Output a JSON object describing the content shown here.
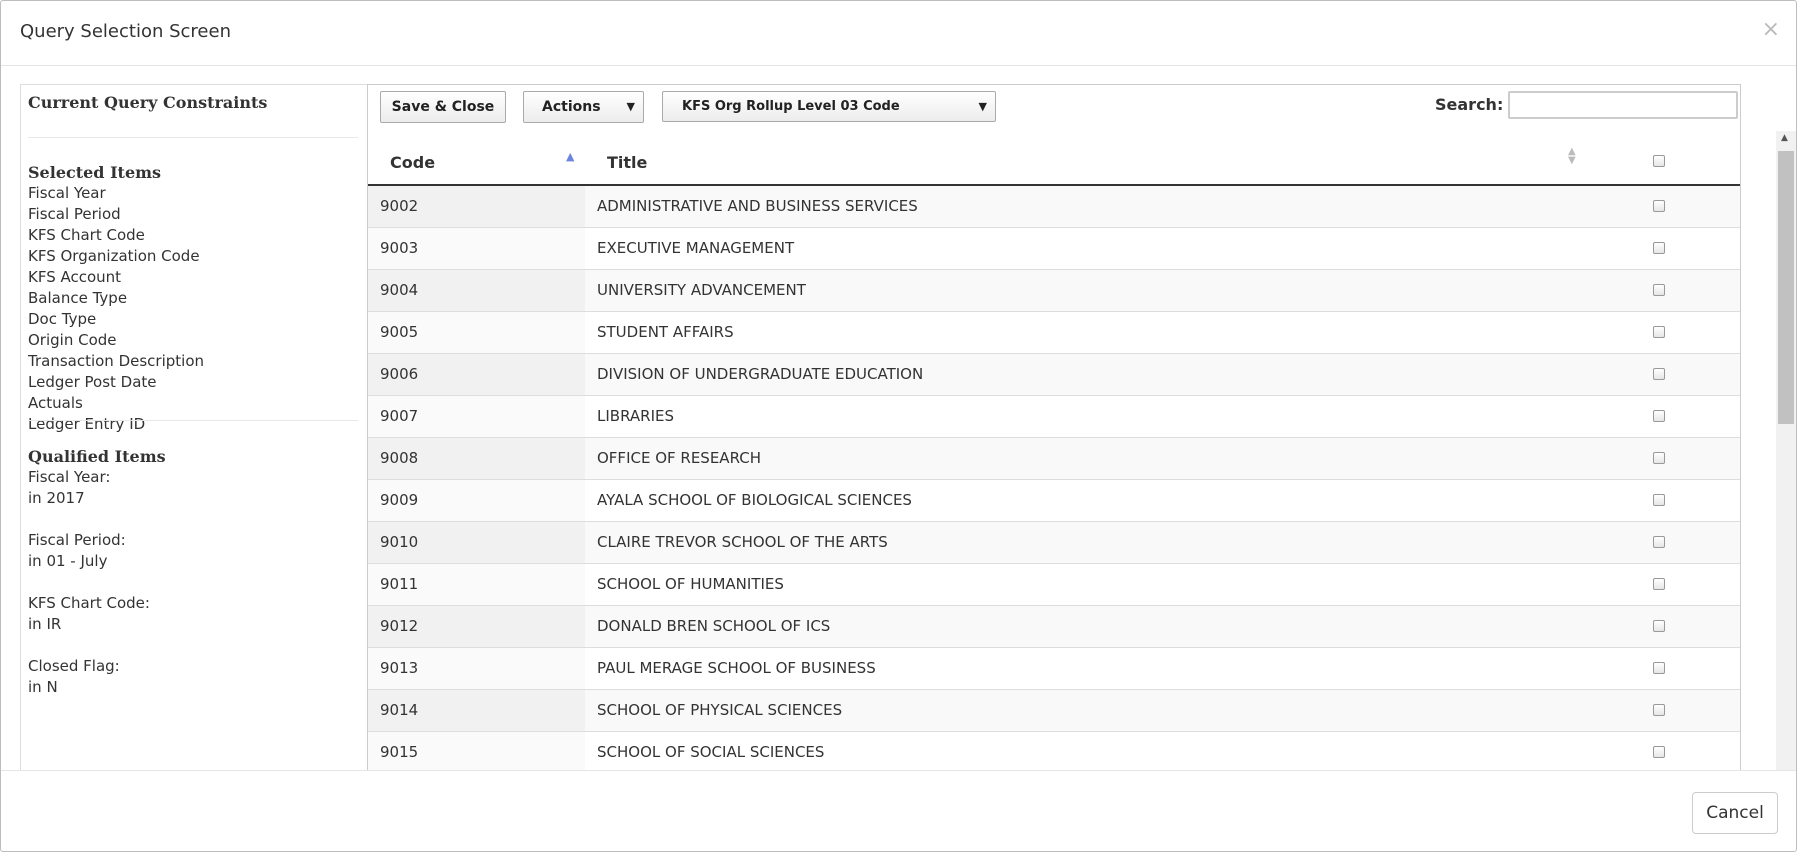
{
  "modal": {
    "title": "Query Selection Screen",
    "close_glyph": "×",
    "cancel_label": "Cancel"
  },
  "left_panel": {
    "title": "Current Query Constraints",
    "selected_heading": "Selected Items",
    "selected_items": [
      "Fiscal Year",
      "Fiscal Period",
      "KFS Chart Code",
      "KFS Organization Code",
      "KFS Account",
      "Balance Type",
      "Doc Type",
      "Origin Code",
      "Transaction Description",
      "Ledger Post Date",
      "Actuals",
      "Ledger Entry ID"
    ],
    "qualified_heading": "Qualified Items",
    "qualified_items": [
      {
        "label": "Fiscal Year:",
        "value": "in 2017"
      },
      {
        "label": "Fiscal Period:",
        "value": "in 01 - July"
      },
      {
        "label": "KFS Chart Code:",
        "value": "in IR"
      },
      {
        "label": "Closed Flag:",
        "value": "in N"
      }
    ]
  },
  "toolbar": {
    "save_close_label": "Save & Close",
    "actions_label": "Actions",
    "dimension_label": "KFS Org Rollup Level 03 Code",
    "caret_glyph": "▼",
    "search_label": "Search:",
    "search_value": ""
  },
  "table": {
    "columns": [
      "Code",
      "Title"
    ],
    "sort_column": "Code",
    "rows": [
      {
        "code": "9002",
        "title": "ADMINISTRATIVE AND BUSINESS SERVICES"
      },
      {
        "code": "9003",
        "title": "EXECUTIVE MANAGEMENT"
      },
      {
        "code": "9004",
        "title": "UNIVERSITY ADVANCEMENT"
      },
      {
        "code": "9005",
        "title": "STUDENT AFFAIRS"
      },
      {
        "code": "9006",
        "title": "DIVISION OF UNDERGRADUATE EDUCATION"
      },
      {
        "code": "9007",
        "title": "LIBRARIES"
      },
      {
        "code": "9008",
        "title": "OFFICE OF RESEARCH"
      },
      {
        "code": "9009",
        "title": "AYALA SCHOOL OF BIOLOGICAL SCIENCES"
      },
      {
        "code": "9010",
        "title": "CLAIRE TREVOR SCHOOL OF THE ARTS"
      },
      {
        "code": "9011",
        "title": "SCHOOL OF HUMANITIES"
      },
      {
        "code": "9012",
        "title": "DONALD BREN SCHOOL OF ICS"
      },
      {
        "code": "9013",
        "title": "PAUL MERAGE SCHOOL OF BUSINESS"
      },
      {
        "code": "9014",
        "title": "SCHOOL OF PHYSICAL SCIENCES"
      },
      {
        "code": "9015",
        "title": "SCHOOL OF SOCIAL SCIENCES"
      }
    ]
  },
  "colors": {
    "sort_indicator": "#6d84e0",
    "header_rule": "#333333"
  }
}
